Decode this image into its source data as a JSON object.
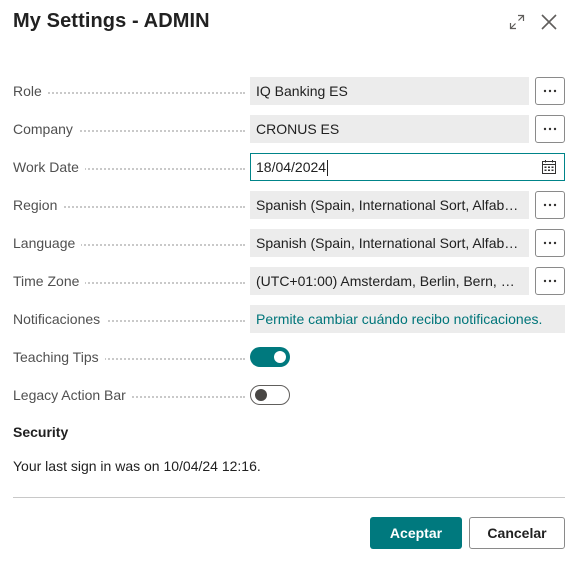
{
  "dialog": {
    "title": "My Settings - ADMIN"
  },
  "fields": {
    "role": {
      "label": "Role",
      "value": "IQ Banking ES"
    },
    "company": {
      "label": "Company",
      "value": "CRONUS ES"
    },
    "work_date": {
      "label": "Work Date",
      "value": "18/04/2024"
    },
    "region": {
      "label": "Region",
      "value": "Spanish (Spain, International Sort, Alfabet..."
    },
    "language": {
      "label": "Language",
      "value": "Spanish (Spain, International Sort, Alfabet..."
    },
    "time_zone": {
      "label": "Time Zone",
      "value": "(UTC+01:00) Amsterdam, Berlin, Bern, Ro..."
    },
    "notifications": {
      "label": "Notificaciones",
      "value": "Permite cambiar cuándo recibo notificaciones."
    },
    "teaching_tips": {
      "label": "Teaching Tips",
      "state": "on"
    },
    "legacy_action_bar": {
      "label": "Legacy Action Bar",
      "state": "off"
    }
  },
  "security": {
    "title": "Security",
    "text": "Your last sign in was on 10/04/24 12:16."
  },
  "buttons": {
    "ok": "Aceptar",
    "cancel": "Cancelar"
  },
  "icons": {
    "expand": "expand-icon",
    "close": "close-icon",
    "lookup": "ellipsis-icon",
    "calendar": "calendar-icon"
  },
  "colors": {
    "accent": "#00797e",
    "link": "#00757a",
    "field_bg": "#ececec"
  }
}
